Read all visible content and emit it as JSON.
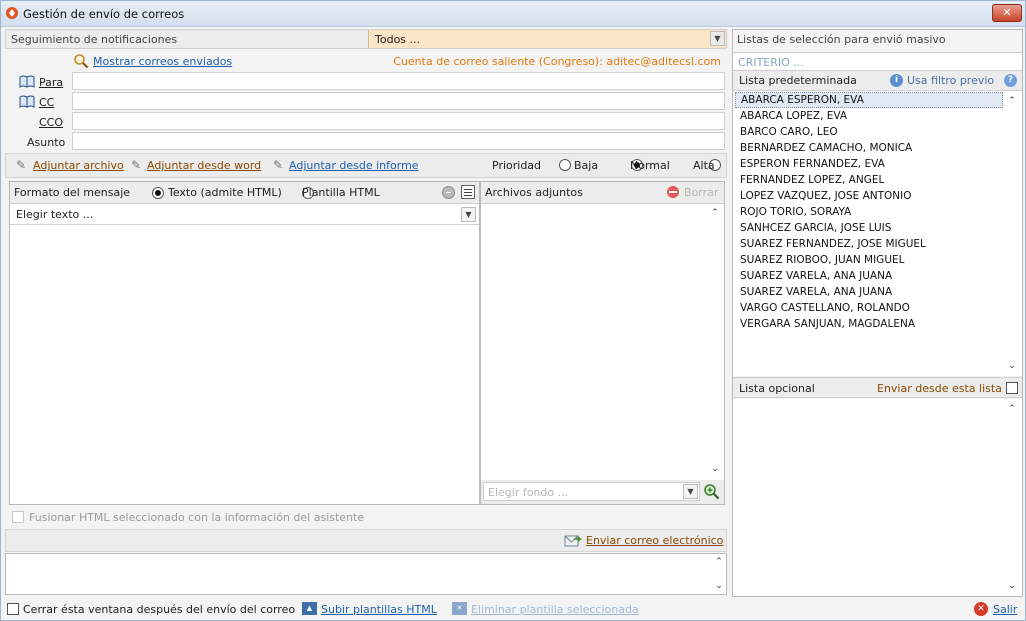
{
  "window": {
    "title": "Gestión de envío de correos",
    "close_label": "✕"
  },
  "notifications": {
    "label": "Seguimiento de notificaciones",
    "filter_value": "Todos ..."
  },
  "mail": {
    "show_sent_link": "Mostrar correos enviados",
    "outgoing_account": "Cuenta de correo saliente (Congreso): aditec@aditecsl.com",
    "to_label": "Para",
    "cc_label": "CC",
    "bcc_label": "CCO",
    "subject_label": "Asunto",
    "to_value": "",
    "cc_value": "",
    "bcc_value": "",
    "subject_value": ""
  },
  "attach_bar": {
    "attach_file": "Adjuntar archivo",
    "attach_word": "Adjuntar desde word",
    "attach_report": "Adjuntar desde informe",
    "priority_label": "Prioridad",
    "priority_options": [
      "Baja",
      "Normal",
      "Alta"
    ],
    "priority_selected": "Normal"
  },
  "message": {
    "format_label": "Formato del mensaje",
    "format_text": "Texto (admite HTML)",
    "format_template": "Plantilla HTML",
    "choose_text": "Elegir texto ..."
  },
  "attachments": {
    "label": "Archivos adjuntos",
    "delete_label": "Borrar",
    "choose_background": "Elegir fondo ..."
  },
  "merge": {
    "label": "Fusionar HTML seleccionado con la información del asistente"
  },
  "send": {
    "label": "Enviar correo electrónico"
  },
  "footer": {
    "close_after_send": "Cerrar ésta ventana después del envío del correo",
    "upload_templates": "Subir plantillas HTML",
    "delete_template": "Eliminar plantilla seleccionada",
    "exit": "Salir"
  },
  "mass_lists": {
    "title": "Listas de selección para envió masivo",
    "criteria_placeholder": "CRITERIO ...",
    "default_list_label": "Lista predeterminada",
    "use_filter_label": "Usa filtro previo",
    "default_list": [
      "ABARCA ESPERON, EVA",
      "ABARCA LOPEZ, EVA",
      "BARCO CARO, LEO",
      "BERNARDEZ CAMACHO, MONICA",
      "ESPERON FERNANDEZ, EVA",
      "FERNANDEZ LOPEZ, ANGEL",
      "LOPEZ VAZQUEZ, JOSE ANTONIO",
      "ROJO TORIO, SORAYA",
      "SANHCEZ GARCIA, JOSE LUIS",
      "SUAREZ FERNANDEZ, JOSE MIGUEL",
      "SUAREZ RIOBOO, JUAN MIGUEL",
      "SUAREZ VARELA, ANA JUANA",
      "SUAREZ VARELA, ANA JUANA",
      "VARGO CASTELLANO, ROLANDO",
      "VERGARA SANJUAN, MAGDALENA"
    ],
    "optional_list_label": "Lista opcional",
    "send_from_list_label": "Enviar desde esta lista"
  },
  "colors": {
    "accent_orange": "#e07a12",
    "link_blue": "#1f5fb0",
    "close_red": "#c8442b"
  }
}
